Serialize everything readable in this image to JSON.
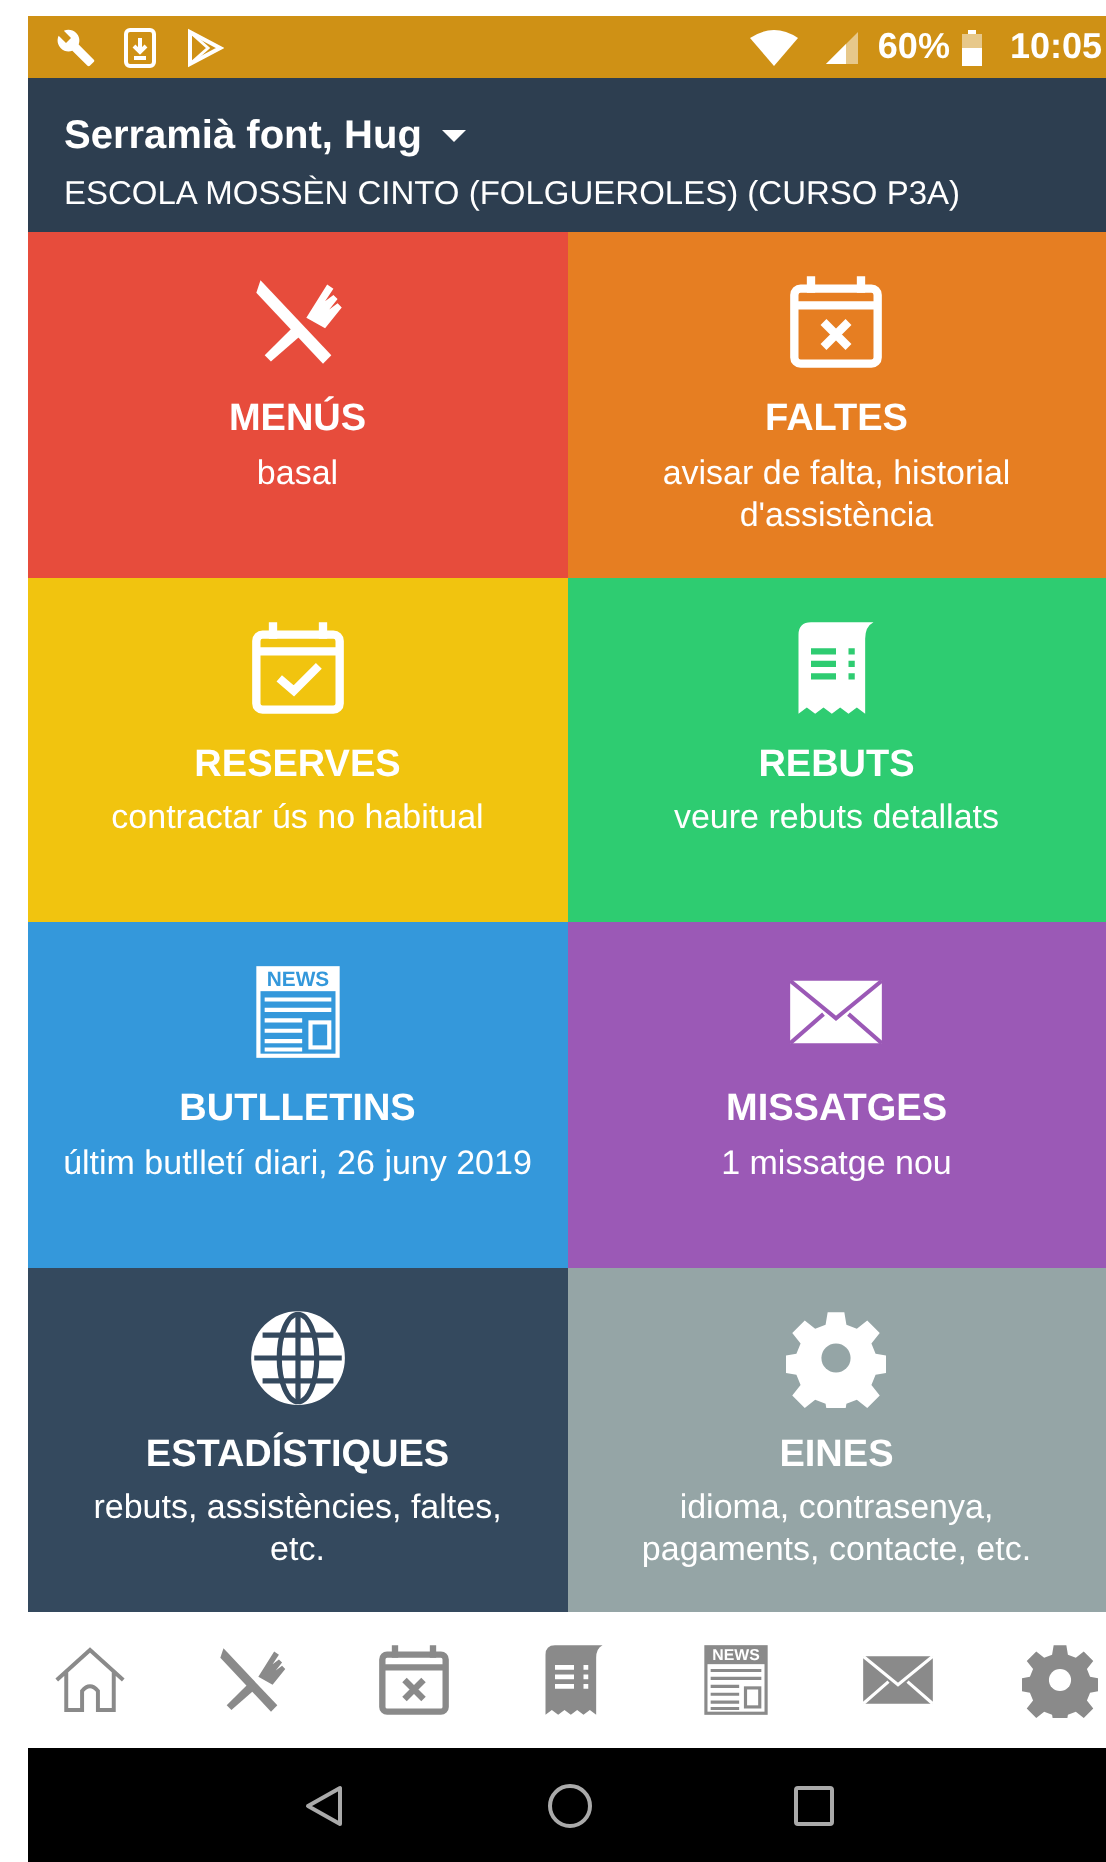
{
  "status_bar": {
    "battery": "60%",
    "time": "10:05"
  },
  "header": {
    "student": "Serramià font, Hug",
    "school": "ESCOLA MOSSÈN CINTO (FOLGUEROLES) (CURSO P3A)"
  },
  "tiles": [
    {
      "title": "MENÚS",
      "subtitle": "basal",
      "kind": "cutlery",
      "color": "#e74c3c"
    },
    {
      "title": "FALTES",
      "subtitle": "avisar de falta, historial d'assistència",
      "kind": "absence",
      "color": "#e67e22"
    },
    {
      "title": "RESERVES",
      "subtitle": "contractar ús no habitual",
      "kind": "booking",
      "color": "#f1c40f"
    },
    {
      "title": "REBUTS",
      "subtitle": "veure rebuts detallats",
      "kind": "receipt",
      "color": "#2ecc71"
    },
    {
      "title": "BUTLLETINS",
      "subtitle": "últim butlletí diari, 26 juny 2019",
      "kind": "news",
      "icon_text": "NEWS",
      "color": "#3498db"
    },
    {
      "title": "MISSATGES",
      "subtitle": "1 missatge nou",
      "kind": "mail",
      "color": "#9b59b6"
    },
    {
      "title": "ESTADÍSTIQUES",
      "subtitle": "rebuts, assistències, faltes, etc.",
      "kind": "globe",
      "color": "#34495e"
    },
    {
      "title": "EINES",
      "subtitle": "idioma, contrasenya, pagaments, contacte, etc.",
      "kind": "gear",
      "color": "#95a5a6"
    }
  ],
  "bottom_nav": [
    {
      "kind": "home"
    },
    {
      "kind": "cutlery"
    },
    {
      "kind": "absence"
    },
    {
      "kind": "receipt"
    },
    {
      "kind": "news",
      "icon_text": "NEWS"
    },
    {
      "kind": "mail"
    },
    {
      "kind": "gear"
    }
  ]
}
